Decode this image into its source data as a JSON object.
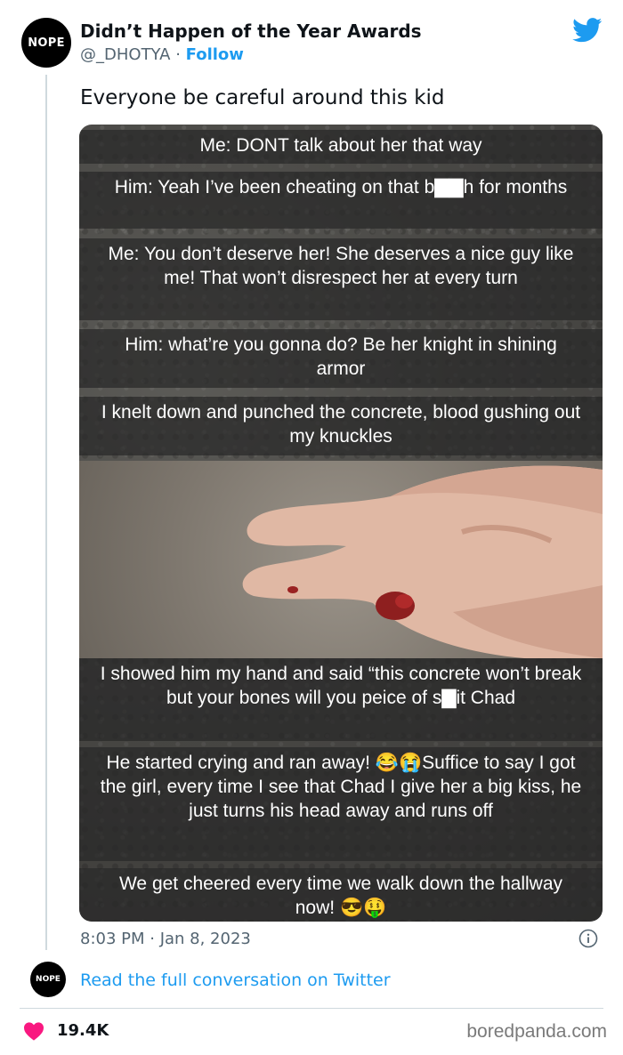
{
  "author": {
    "avatar_text": "NOPE",
    "display_name": "Didn’t Happen of the Year Awards",
    "handle": "@_DHOTYA",
    "separator": " · ",
    "follow_label": "Follow"
  },
  "tweet": {
    "text": "Everyone be careful around this kid",
    "timestamp": "8:03 PM · Jan 8, 2023"
  },
  "media": {
    "captions": [
      "Me: DONT talk about her that way",
      "Him: Yeah I’ve been cheating on that b▇▇h for months",
      "Me: You don’t deserve her! She deserves a nice guy like me! That won’t disrespect her at every turn",
      "Him: what’re you gonna do? Be her knight in shining armor",
      "I knelt down and punched the concrete, blood gushing out my knuckles",
      "I showed him my hand and said “this concrete won’t break but your bones will you peice of s▇it Chad",
      "He started crying and ran away! 😂😭Suffice to say I got the girl, every time I see that Chad I give her a big kiss, he just turns his head away and runs off",
      "We get cheered every time we walk down the hallway now! 😎🤑"
    ]
  },
  "footer": {
    "avatar_text": "NOPE",
    "read_link": "Read the full conversation on Twitter",
    "likes": "19.4K",
    "watermark": "boredpanda.com"
  },
  "colors": {
    "accent": "#1d9bf0",
    "heart": "#f91880",
    "muted": "#536471"
  }
}
